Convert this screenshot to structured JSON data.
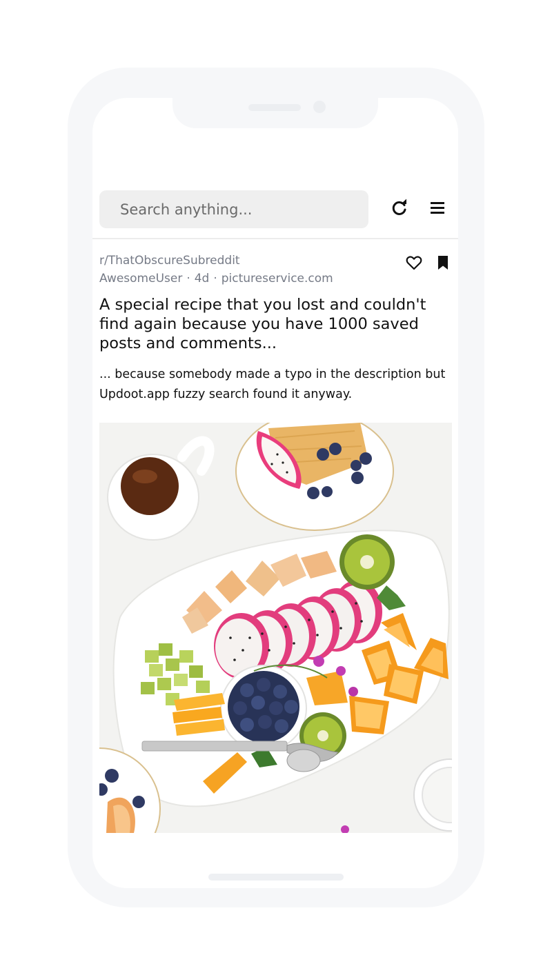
{
  "colors": {
    "frame": "#f6f7f9",
    "search_bg": "#efefef",
    "meta_text": "#757a86",
    "title_text": "#111111"
  },
  "topbar": {
    "search_placeholder": "Search anything...",
    "refresh_icon": "refresh-icon",
    "menu_icon": "hamburger-menu-icon"
  },
  "post": {
    "subreddit": "r/ThatObscureSubreddit",
    "author": "AwesomeUser",
    "age": "4d",
    "domain": "pictureservice.com",
    "separator": "·",
    "title": "A special recipe that you lost and couldn't find again because you have 1000 saved posts and comments...",
    "description": "... because somebody made a typo in the description but Updoot.app fuzzy search found it anyway.",
    "like_icon": "heart-outline-icon",
    "save_icon": "bookmark-filled-icon",
    "image_content": "fruit platter photo"
  }
}
